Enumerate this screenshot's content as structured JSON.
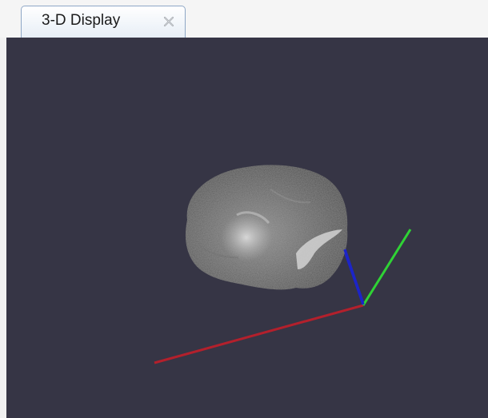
{
  "tab": {
    "title": "3-D Display",
    "close_icon": "close-icon"
  },
  "viewport": {
    "background_color": "#363545",
    "axis_colors": {
      "x": "#b3202c",
      "y": "#2fd335",
      "z": "#1c24c8"
    },
    "object": "brain-volume-render"
  }
}
